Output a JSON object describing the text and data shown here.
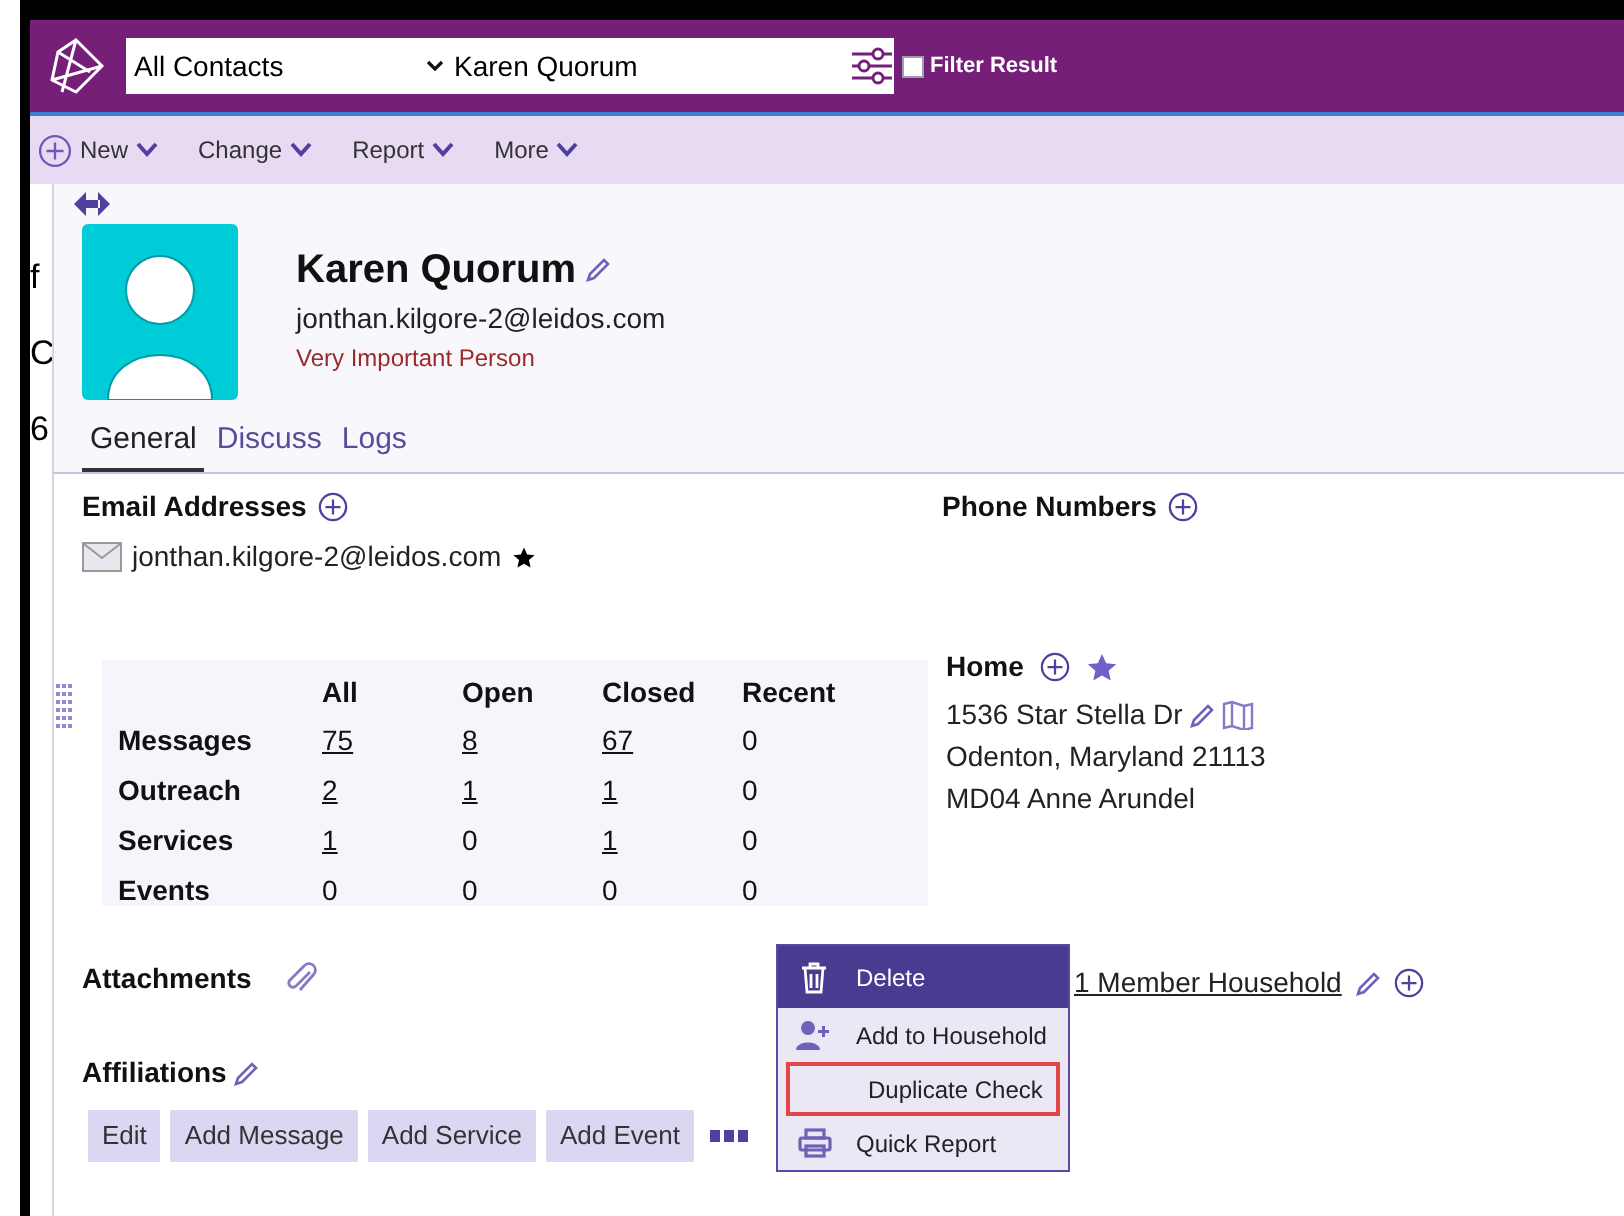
{
  "header": {
    "scope": "All Contacts",
    "contact": "Karen Quorum",
    "filter_result": {
      "label": "Filter Result",
      "checked": false
    }
  },
  "toolbar": [
    {
      "label": "New",
      "kind": "add"
    },
    {
      "label": "Change",
      "kind": "menu"
    },
    {
      "label": "Report",
      "kind": "menu"
    },
    {
      "label": "More",
      "kind": "menu"
    }
  ],
  "background_fragments": [
    "f",
    "C",
    "6"
  ],
  "profile": {
    "name": "Karen Quorum",
    "email": "jonthan.kilgore-2@leidos.com",
    "tag": "Very Important Person"
  },
  "tabs": [
    {
      "label": "General",
      "selected": true
    },
    {
      "label": "Discuss",
      "selected": false
    },
    {
      "label": "Logs",
      "selected": false
    }
  ],
  "email_section": {
    "title": "Email Addresses",
    "emails": [
      {
        "address": "jonthan.kilgore-2@leidos.com",
        "primary": true
      }
    ]
  },
  "phone_section": {
    "title": "Phone Numbers"
  },
  "summary_table": {
    "columns": [
      "All",
      "Open",
      "Closed",
      "Recent"
    ],
    "rows": [
      {
        "label": "Messages",
        "cells": [
          {
            "text": "75",
            "link": true
          },
          {
            "text": "8",
            "link": true
          },
          {
            "text": "67",
            "link": true
          },
          {
            "text": "0",
            "link": false
          }
        ]
      },
      {
        "label": "Outreach",
        "cells": [
          {
            "text": "2",
            "link": true
          },
          {
            "text": "1",
            "link": true
          },
          {
            "text": "1",
            "link": true
          },
          {
            "text": "0",
            "link": false
          }
        ]
      },
      {
        "label": "Services",
        "cells": [
          {
            "text": "1",
            "link": true
          },
          {
            "text": "0",
            "link": false
          },
          {
            "text": "1",
            "link": true
          },
          {
            "text": "0",
            "link": false
          }
        ]
      },
      {
        "label": "Events",
        "cells": [
          {
            "text": "0",
            "link": false
          },
          {
            "text": "0",
            "link": false
          },
          {
            "text": "0",
            "link": false
          },
          {
            "text": "0",
            "link": false
          }
        ]
      }
    ]
  },
  "address": {
    "title": "Home",
    "lines": [
      "1536 Star Stella Dr",
      "Odenton, Maryland 21113",
      "MD04 Anne Arundel"
    ]
  },
  "attachments": {
    "title": "Attachments"
  },
  "affiliations": {
    "title": "Affiliations"
  },
  "household": "1 Member Household",
  "actions": [
    "Edit",
    "Add Message",
    "Add Service",
    "Add Event"
  ],
  "menu": [
    {
      "label": "Delete",
      "kind": "delete",
      "selected": true,
      "outlined": false
    },
    {
      "label": "Add to Household",
      "kind": "person",
      "selected": false,
      "outlined": false
    },
    {
      "label": "Duplicate Check",
      "kind": "none",
      "selected": false,
      "outlined": true
    },
    {
      "label": "Quick Report",
      "kind": "print",
      "selected": false,
      "outlined": false
    }
  ]
}
